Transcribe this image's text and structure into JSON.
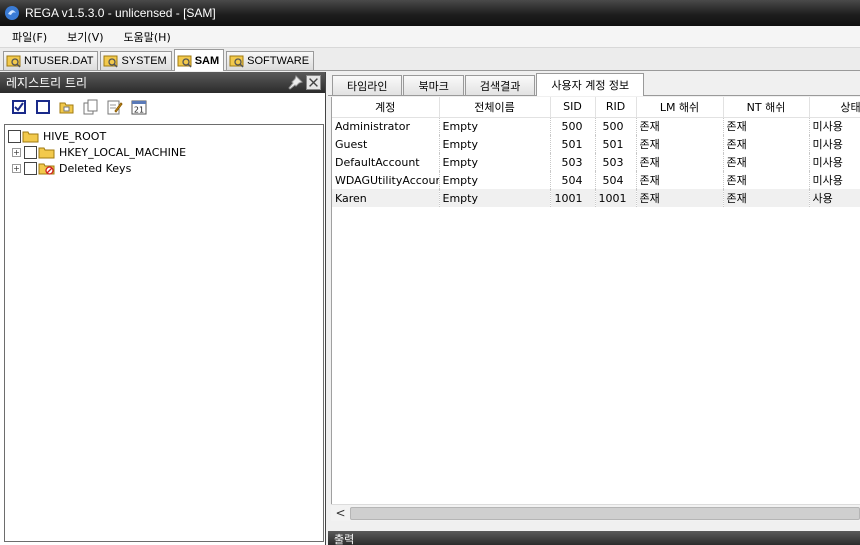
{
  "window": {
    "title": "REGA v1.5.3.0 - unlicensed - [SAM]"
  },
  "menu": [
    {
      "label": "파일(F)"
    },
    {
      "label": "보기(V)"
    },
    {
      "label": "도움말(H)"
    }
  ],
  "doc_tabs": [
    {
      "label": "NTUSER.DAT",
      "active": false
    },
    {
      "label": "SYSTEM",
      "active": false
    },
    {
      "label": "SAM",
      "active": true
    },
    {
      "label": "SOFTWARE",
      "active": false
    }
  ],
  "left_pane": {
    "title": "레지스트리 트리",
    "toolbar_icons": [
      "check-all-icon",
      "uncheck-all-icon",
      "open-folder-icon",
      "copy-icon",
      "edit-icon",
      "calendar-icon"
    ],
    "calendar_day": "21",
    "tree": [
      {
        "label": "HIVE_ROOT",
        "icon": "folder-icon",
        "level": 0,
        "expander": ""
      },
      {
        "label": "HKEY_LOCAL_MACHINE",
        "icon": "folder-icon",
        "level": 1,
        "expander": "+"
      },
      {
        "label": "Deleted Keys",
        "icon": "deleted-folder-icon",
        "level": 1,
        "expander": "+"
      }
    ]
  },
  "right_pane": {
    "tabs": [
      {
        "label": "타임라인",
        "active": false
      },
      {
        "label": "북마크",
        "active": false
      },
      {
        "label": "검색결과",
        "active": false
      },
      {
        "label": "사용자 계정 정보",
        "active": true
      }
    ],
    "columns": [
      "계정",
      "전체이름",
      "SID",
      "RID",
      "LM 해쉬",
      "NT 해쉬",
      "상태"
    ],
    "rows": [
      {
        "account": "Administrator",
        "fullname": "Empty",
        "sid": "500",
        "rid": "500",
        "lm": "존재",
        "nt": "존재",
        "status": "미사용"
      },
      {
        "account": "Guest",
        "fullname": "Empty",
        "sid": "501",
        "rid": "501",
        "lm": "존재",
        "nt": "존재",
        "status": "미사용"
      },
      {
        "account": "DefaultAccount",
        "fullname": "Empty",
        "sid": "503",
        "rid": "503",
        "lm": "존재",
        "nt": "존재",
        "status": "미사용"
      },
      {
        "account": "WDAGUtilityAccount",
        "fullname": "Empty",
        "sid": "504",
        "rid": "504",
        "lm": "존재",
        "nt": "존재",
        "status": "미사용"
      },
      {
        "account": "Karen",
        "fullname": "Empty",
        "sid": "1001",
        "rid": "1001",
        "lm": "존재",
        "nt": "존재",
        "status": "사용"
      }
    ],
    "selected_row": 4,
    "scroll_left_glyph": "<",
    "output_title": "출력"
  },
  "colors": {
    "titlebar": "#1e1e1e",
    "pane_header": "#2b2b2b",
    "folder": "#f2c94c"
  }
}
